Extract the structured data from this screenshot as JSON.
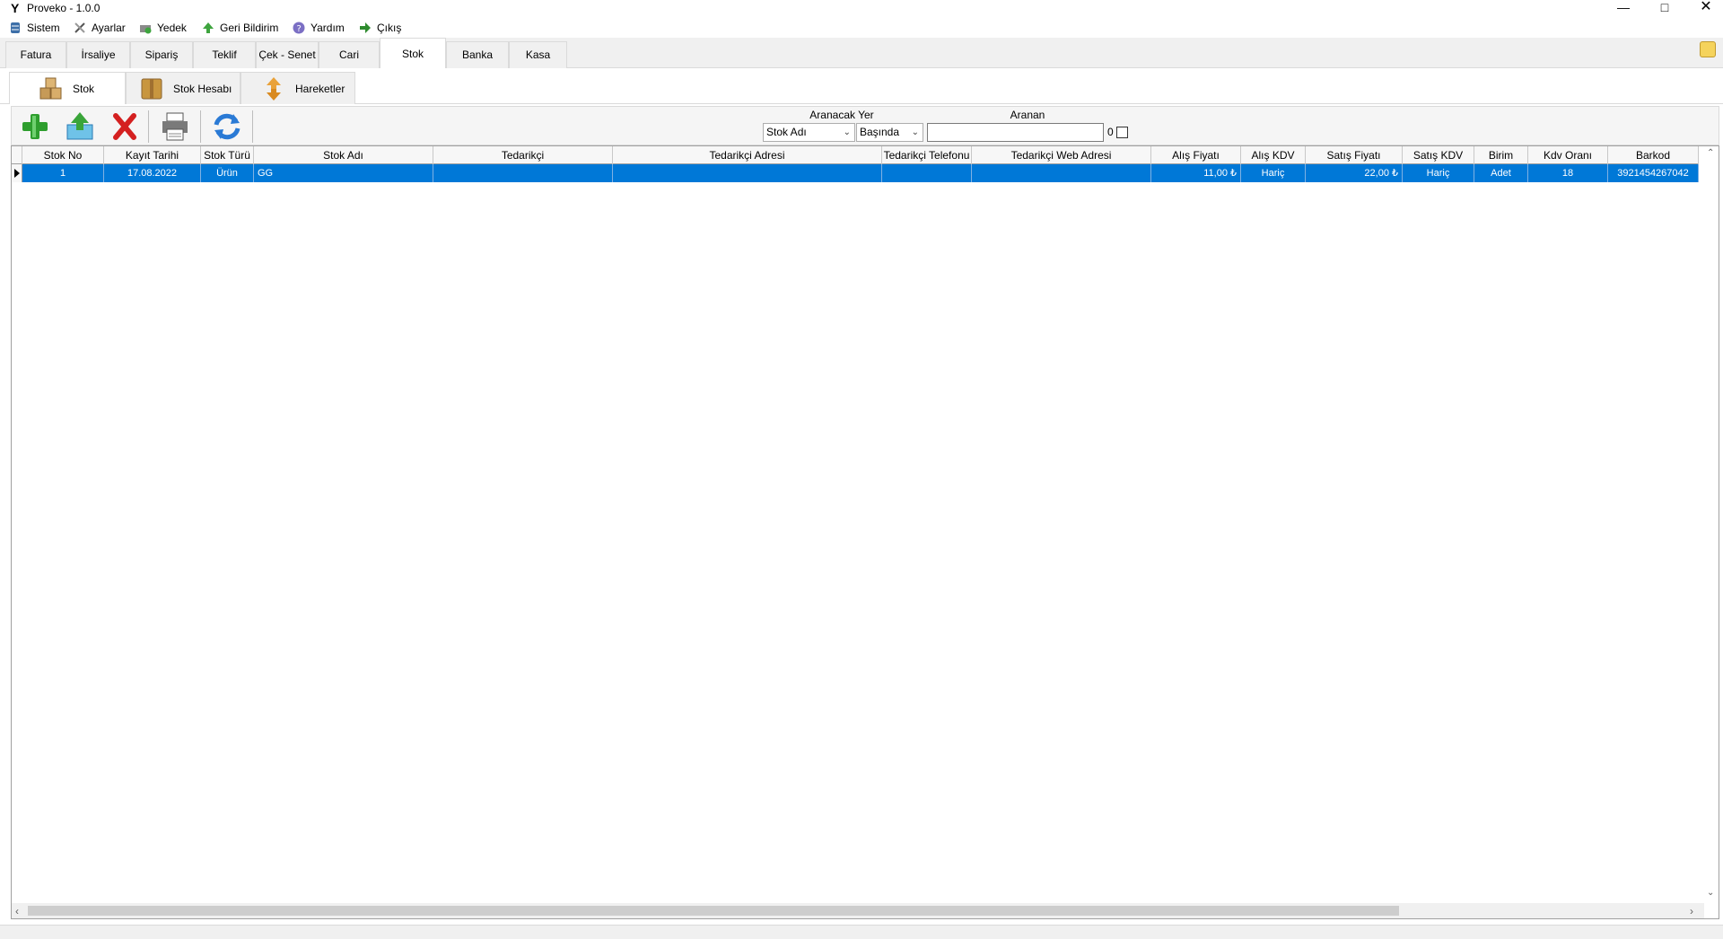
{
  "window": {
    "title": "Proveko - 1.0.0"
  },
  "menu": [
    {
      "label": "Sistem",
      "icon": "database-icon"
    },
    {
      "label": "Ayarlar",
      "icon": "tools-icon"
    },
    {
      "label": "Yedek",
      "icon": "backup-icon"
    },
    {
      "label": "Geri Bildirim",
      "icon": "arrow-up-icon"
    },
    {
      "label": "Yardım",
      "icon": "help-icon"
    },
    {
      "label": "Çıkış",
      "icon": "exit-icon"
    }
  ],
  "tabs": [
    "Fatura",
    "İrsaliye",
    "Sipariş",
    "Teklif",
    "Çek - Senet",
    "Cari",
    "Stok",
    "Banka",
    "Kasa"
  ],
  "active_tab": "Stok",
  "subtabs": [
    "Stok",
    "Stok Hesabı",
    "Hareketler"
  ],
  "search": {
    "field_label": "Aranacak Yer",
    "term_label": "Aranan",
    "field_value": "Stok Adı",
    "mode_value": "Başında",
    "term_value": "",
    "count": "0"
  },
  "grid": {
    "columns": [
      "Stok No",
      "Kayıt Tarihi",
      "Stok Türü",
      "Stok Adı",
      "Tedarikçi",
      "Tedarikçi Adresi",
      "Tedarikçi Telefonu",
      "Tedarikçi Web Adresi",
      "Alış Fiyatı",
      "Alış KDV",
      "Satış Fiyatı",
      "Satış KDV",
      "Birim",
      "Kdv Oranı",
      "Barkod"
    ],
    "rows": [
      [
        "1",
        "17.08.2022",
        "Ürün",
        "GG",
        "",
        "",
        "",
        "",
        "11,00 ₺",
        "Hariç",
        "22,00 ₺",
        "Hariç",
        "Adet",
        "18",
        "3921454267042"
      ]
    ]
  },
  "colors": {
    "selection": "#0078d7",
    "add": "#2e9e2e",
    "delete": "#d42020",
    "refresh": "#2a7ad5"
  }
}
